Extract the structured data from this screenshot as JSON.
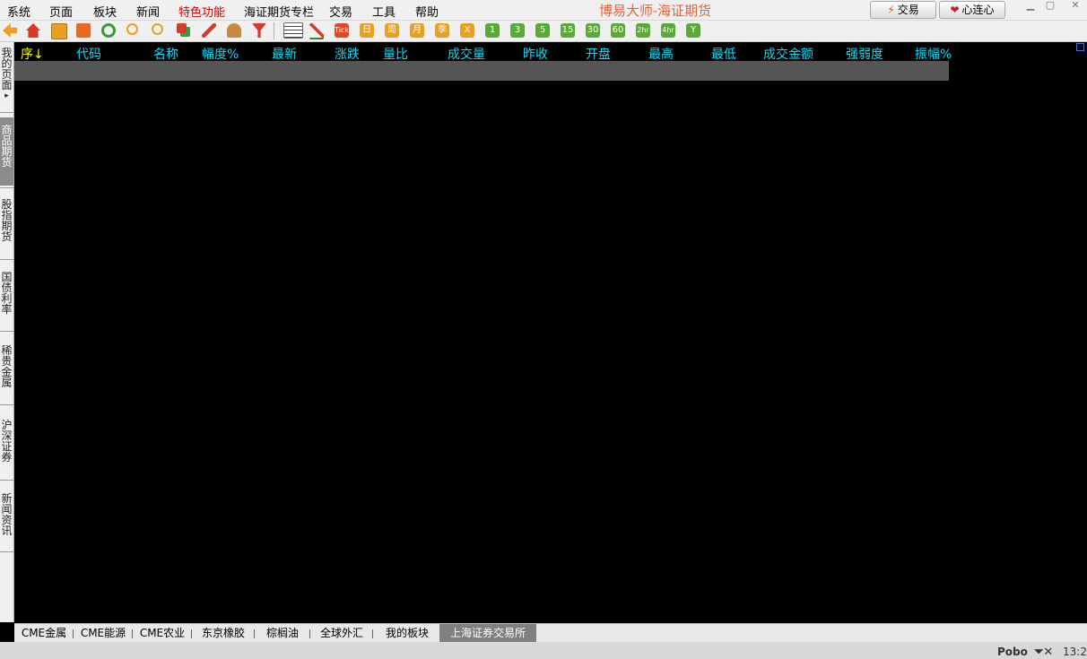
{
  "menubar": {
    "items": [
      "系统",
      "页面",
      "板块",
      "新闻",
      "特色功能",
      "海证期货专栏",
      "交易",
      "工具",
      "帮助"
    ],
    "title": "博易大师-海证期货",
    "trade_button": "交易",
    "heart_button": "心连心"
  },
  "toolbar": {
    "period_buttons": [
      "Tick",
      "日",
      "周",
      "月",
      "季",
      "X",
      "1",
      "3",
      "5",
      "15",
      "30",
      "60",
      "2hr",
      "4hr",
      "Y"
    ]
  },
  "sidebar": {
    "tabs": [
      "我的页面",
      "商品期货",
      "股指期货",
      "国债利率",
      "稀贵金属",
      "沪深证券",
      "新闻资讯"
    ],
    "active_index": 1
  },
  "table": {
    "columns": [
      "序↓",
      "代码",
      "名称",
      "幅度%",
      "最新",
      "涨跌",
      "量比",
      "成交量",
      "昨收",
      "开盘",
      "最高",
      "最低",
      "成交金额",
      "强弱度",
      "振幅%"
    ]
  },
  "bottom_tabs": {
    "items": [
      "CME金属",
      "CME能源",
      "CME农业",
      "东京橡胶",
      "棕榈油",
      "全球外汇",
      "我的板块",
      "上海证券交易所"
    ],
    "active_index": 7
  },
  "status": {
    "brand": "Pobo",
    "time": "13:2"
  },
  "colors": {
    "background": "#000000",
    "header_text": "#00e0ff",
    "sort_column_text": "#ffff00",
    "title_text": "#e8603c",
    "special_menu": "#d00000"
  }
}
